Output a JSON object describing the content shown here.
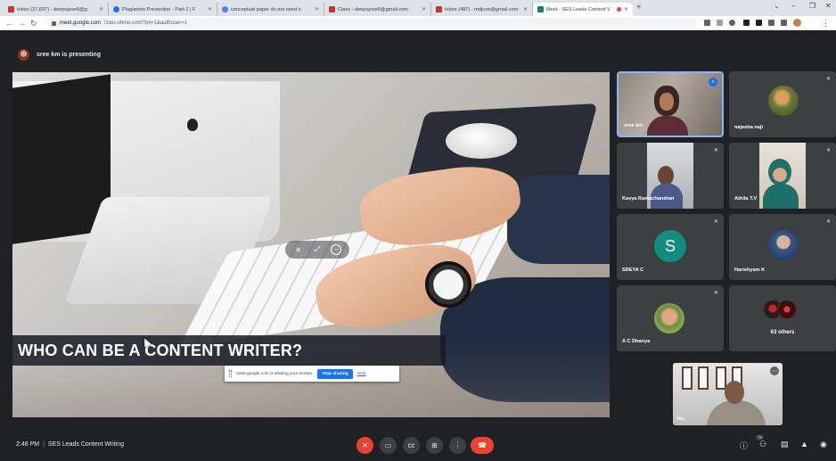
{
  "browser": {
    "tabs": [
      {
        "title": "Inbox (27,837) - deepujose6@g",
        "icon": "gmail-icon",
        "color": "#d93025",
        "active": false
      },
      {
        "title": "Plagiarism Prevention - Part-2 | F",
        "icon": "circle-logo-icon",
        "color": "#1a73e8",
        "active": false
      },
      {
        "title": "conceptual paper do not need o",
        "icon": "google-icon",
        "color": "#4285f4",
        "active": false
      },
      {
        "title": "Class - deepujose6@gmail.com",
        "icon": "gmail-icon",
        "color": "#d93025",
        "active": false
      },
      {
        "title": "Inbox (487) - mdjose@gmail.com",
        "icon": "gmail-icon",
        "color": "#d93025",
        "active": false
      },
      {
        "title": "Meet - SES Leads Content V",
        "icon": "meet-icon",
        "color": "#00897b",
        "active": true
      }
    ],
    "new_tab": "+",
    "window_controls": {
      "down": "⌄",
      "minimize": "–",
      "restore": "❐",
      "close": "✕"
    },
    "url_host": "meet.google.com",
    "url_path": "/zwu-ohmo-cmh?pli=1&authuser=1"
  },
  "meet": {
    "presenting_text": "sree km is presenting",
    "slide_caption": "WHO CAN BE A CONTENT WRITER?",
    "share_banner": {
      "text": "meet.google.com is sharing your screen.",
      "stop_label": "Stop sharing",
      "hide_label": "Hide"
    },
    "participants": [
      {
        "name": "sree km",
        "avatar_type": "video",
        "muted": false,
        "speaking": true,
        "pinned": true
      },
      {
        "name": "najeeba naji",
        "avatar_type": "photo",
        "muted": true,
        "speaking": false,
        "pinned": false
      },
      {
        "name": "Kavya Ramachandran",
        "avatar_type": "video",
        "muted": true,
        "speaking": false,
        "pinned": false
      },
      {
        "name": "Athila T.V",
        "avatar_type": "video",
        "muted": true,
        "speaking": false,
        "pinned": false
      },
      {
        "name": "SREYA C",
        "avatar_type": "letter",
        "letter": "S",
        "muted": true,
        "speaking": false,
        "pinned": false
      },
      {
        "name": "Harishyam K",
        "avatar_type": "photo",
        "muted": true,
        "speaking": false,
        "pinned": false
      },
      {
        "name": "A C Dhanya",
        "avatar_type": "photo",
        "muted": true,
        "speaking": false,
        "pinned": false
      }
    ],
    "others_label": "63 others",
    "self_label": "You",
    "footer": {
      "time": "2:48 PM",
      "separator": "|",
      "meeting_name": "SES Leads Content Writing",
      "participant_count": "72"
    },
    "colors": {
      "background": "#202124",
      "tile": "#3c4043",
      "danger": "#ea4335",
      "accent": "#1a73e8",
      "letter_avatar": "#128c7e"
    }
  }
}
